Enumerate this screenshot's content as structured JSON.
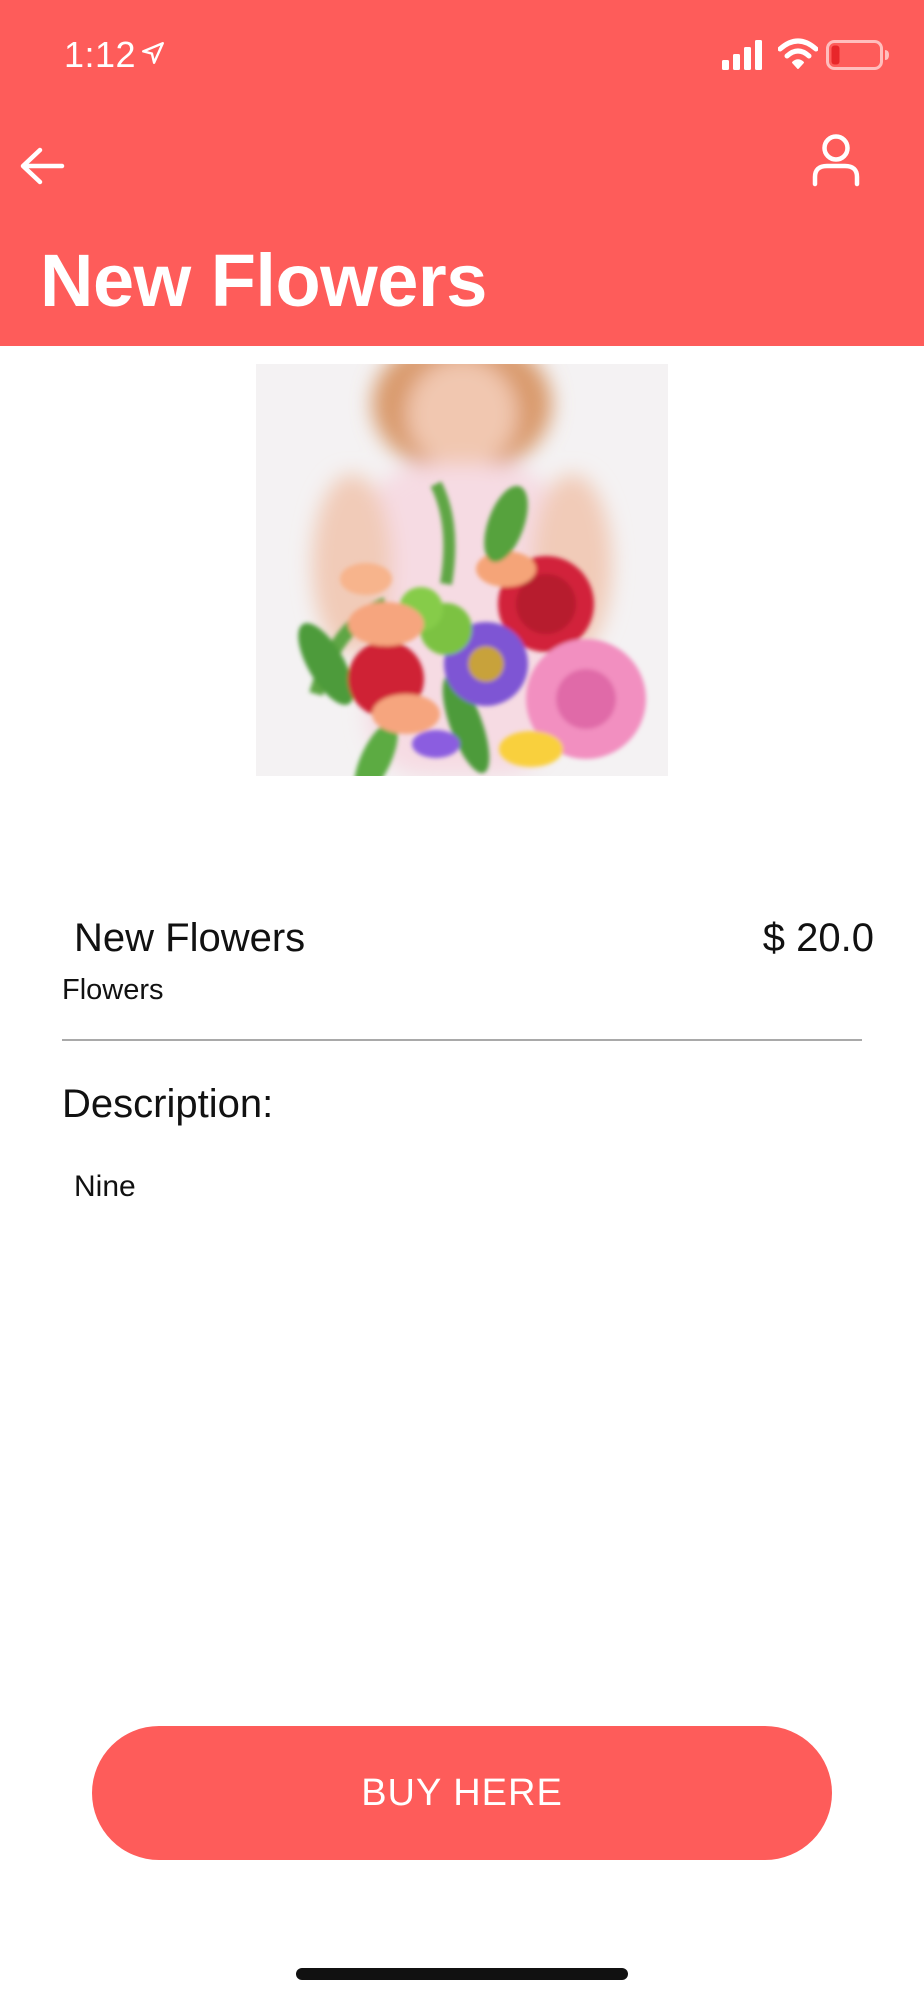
{
  "status_bar": {
    "time": "1:12"
  },
  "header": {
    "title": "New Flowers",
    "back_icon": "arrow-left-icon",
    "profile_icon": "user-icon"
  },
  "product": {
    "image_alt": "bouquet of flowers",
    "name": "New Flowers",
    "price": "$ 20.0",
    "category": "Flowers"
  },
  "description": {
    "heading": "Description:",
    "text": "Nine"
  },
  "actions": {
    "buy_label": "BUY HERE"
  },
  "colors": {
    "accent": "#fe5c5a",
    "text": "#111111",
    "divider": "#a9a9a9"
  }
}
